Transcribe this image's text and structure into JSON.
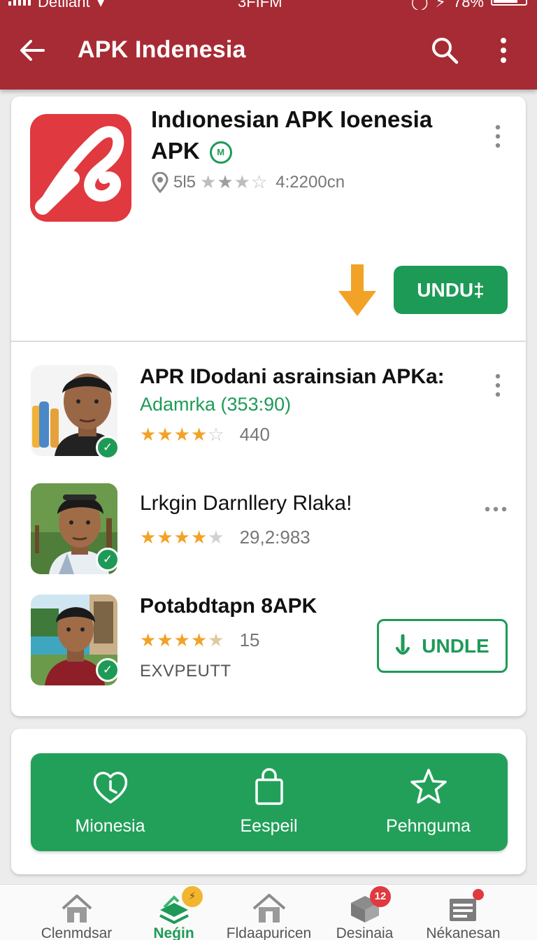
{
  "status_bar": {
    "carrier": "Detilant",
    "time": "3FIFM",
    "battery": "78%"
  },
  "app_bar": {
    "title": "APK Indenesia"
  },
  "featured": {
    "title": "Indıonesian APK Ioenesia APK",
    "badge": "M",
    "rating_prefix": "5l5",
    "rating_stars": 2.5,
    "downloads": "4:2200cn",
    "download_button": "UNDU‡"
  },
  "apps": [
    {
      "title": "APR IDodani asrainsian APKa:",
      "subtitle": "Adamrka (353:90)",
      "rating_stars": 3.5,
      "rating_count": "440"
    },
    {
      "title": "Lrkgin Darnllery Rlaka!",
      "rating_stars": 4,
      "rating_count": "29,2:983"
    },
    {
      "title": "Potabdtapn 8APK",
      "rating_stars": 4.5,
      "rating_count": "15",
      "extra": "EXVPEUTT",
      "button": "UNDLE"
    }
  ],
  "categories": [
    {
      "label": "Mionesia",
      "icon": "clock-heart-icon"
    },
    {
      "label": "Eespeil",
      "icon": "shopping-bag-icon"
    },
    {
      "label": "Pehnguma",
      "icon": "star-icon"
    }
  ],
  "bottom_nav": [
    {
      "label": "Clenmdsar",
      "icon": "home-icon"
    },
    {
      "label": "Neǵin",
      "icon": "apps-stack-icon",
      "active": true
    },
    {
      "label": "Fldaapuricen",
      "icon": "house-icon"
    },
    {
      "label": "Desinaia",
      "icon": "box-icon",
      "badge": "12"
    },
    {
      "label": "Nékanesan",
      "icon": "list-icon"
    }
  ],
  "colors": {
    "app_bar": "#a72b34",
    "accent": "#1e9a57",
    "star": "#f2a227",
    "featured_icon": "#e0393f"
  }
}
